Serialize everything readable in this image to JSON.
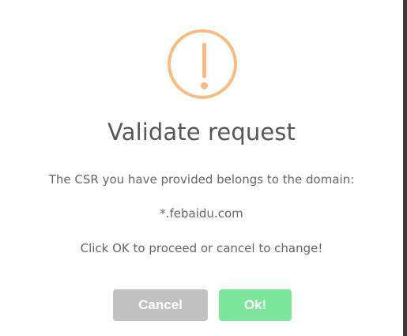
{
  "dialog": {
    "icon": "warning-icon",
    "title": "Validate request",
    "message_line_1": "The CSR you have provided belongs to the domain:",
    "domain": "*.febaidu.com",
    "message_line_3": "Click OK to proceed or cancel to change!"
  },
  "buttons": {
    "cancel_label": "Cancel",
    "ok_label": "Ok!"
  },
  "colors": {
    "warning": "#f8bb86",
    "cancel": "#c1c1c1",
    "ok": "#7ee59d",
    "title": "#575757",
    "body_text": "#666666"
  }
}
